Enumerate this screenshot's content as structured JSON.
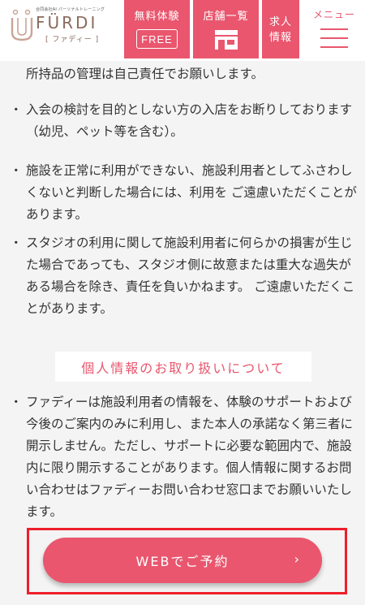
{
  "header": {
    "logo_sub": "合同会社AI パーソナルトレーニング",
    "logo_name": "FÜRDI",
    "logo_kana": "[ ファディー ]",
    "nav": {
      "trial_label": "無料体験",
      "trial_badge": "FREE",
      "store_label": "店舗一覧",
      "job_label_1": "求人",
      "job_label_2": "情報",
      "menu_label": "メニュー"
    }
  },
  "content": {
    "para0": "所持品の管理は自己責任でお願いします。",
    "bullet": "・",
    "para1": "入会の検討を目的としない方の入店をお断りしております（幼児、ペット等を含む）。",
    "para2": "施設を正常に利用ができない、施設利用者としてふさわしくないと判断した場合には、利用を ご遠慮いただくことがあります。",
    "para3": "スタジオの利用に関して施設利用者に何らかの損害が生じた場合であっても、スタジオ側に故意または重大な過失がある場合を除き、責任を負いかねます。 ご遠慮いただくことがあります。",
    "section_title": "個人情報のお取り扱いについて",
    "para4": "ファディーは施設利用者の情報を、体験のサポートおよび今後のご案内のみに利用し、また本人の承諾なく第三者に開示しません。ただし、サポートに必要な範囲内で、施設内に限り開示することがあります。個人情報に関するお問い合わせはファディーお問い合わせ窓口までお願いいたします。"
  },
  "cta": {
    "label": "WEBでご予約",
    "arrow": "›"
  },
  "colors": {
    "accent": "#e9566e",
    "background": "#f4f4f4",
    "highlight_frame": "#ee1e2a"
  }
}
